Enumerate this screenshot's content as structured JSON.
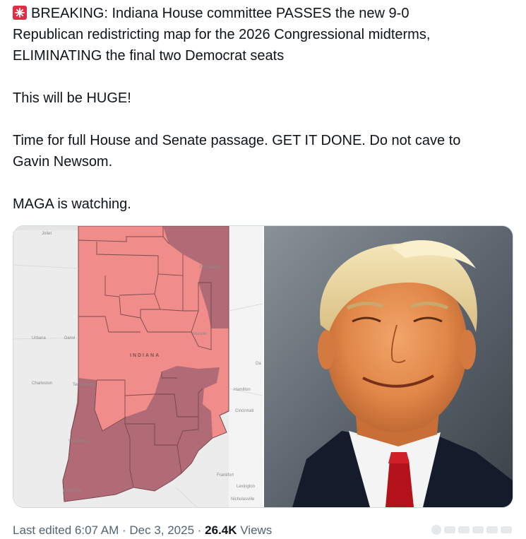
{
  "tweet": {
    "line1": "BREAKING: Indiana House committee PASSES the new 9-0",
    "line2": "Republican redistricting map for the 2026 Congressional midterms,",
    "line3": "ELIMINATING the final two Democrat seats",
    "para2": "This will be HUGE!",
    "para3_line1": "Time for full House and Senate passage. GET IT DONE. Do not cave to",
    "para3_line2": "Gavin Newsom.",
    "para4": "MAGA is watching.",
    "emoji_icon": "siren-icon"
  },
  "map": {
    "state_label": "INDIANA",
    "cities": {
      "joliet": "Joliet",
      "fort_wayne": "Fort Wayne",
      "urbana": "Urbana",
      "danville": "Danvi",
      "charleston": "Charleston",
      "terre_haute": "Terre Haute",
      "hamilton": "Hamilton",
      "cincinnati": "Cincinnati",
      "vincennes": "Vincennes",
      "frankfort": "Frankfort",
      "evansville": "Evansville",
      "lexington": "Lexington",
      "nicholasville": "Nicholasville",
      "muncie": "Muncie",
      "dayton": "Da"
    },
    "colors": {
      "republican": "#f08c8a",
      "democrat_dark": "#b16b76",
      "background": "#ececec",
      "border": "#5a3a3a"
    }
  },
  "footer": {
    "last_edited": "Last edited 6:07 AM · Dec 3, 2025 · ",
    "views_count": "26.4K",
    "views_label": " Views"
  }
}
